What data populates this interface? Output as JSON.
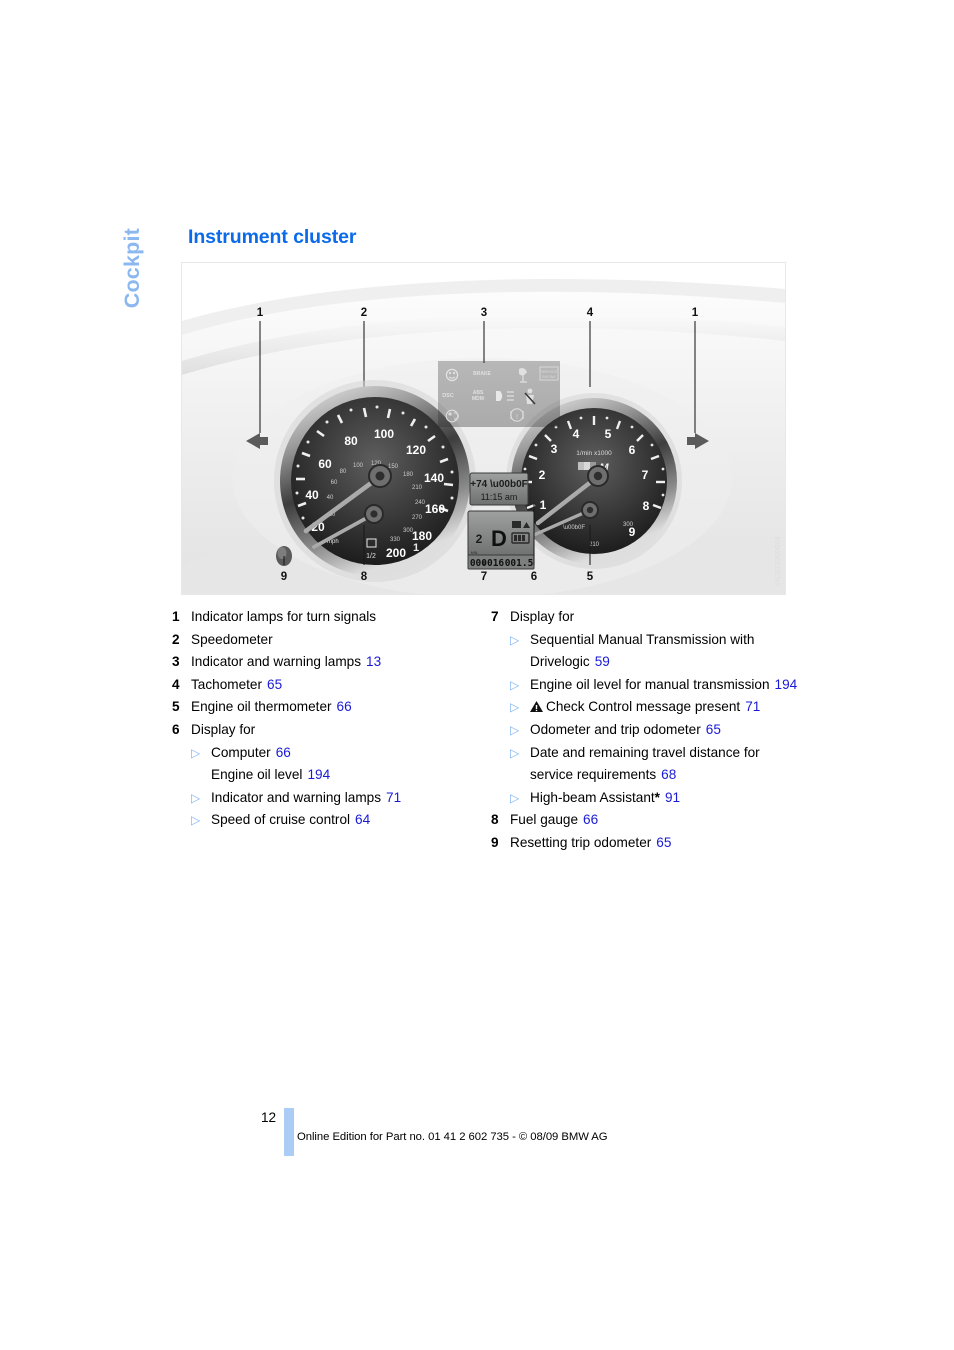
{
  "chapter_tab": {
    "label": "Cockpit",
    "color": "#8cb8f0"
  },
  "heading": {
    "title": "Instrument cluster",
    "color": "#0a6ae8"
  },
  "figure": {
    "alt": "BMW instrument cluster with speedometer and tachometer",
    "image_code": "VIC010200004",
    "callouts_top": [
      "1",
      "2",
      "3",
      "4",
      "1"
    ],
    "callouts_bottom": [
      "9",
      "8",
      "7",
      "6",
      "5"
    ],
    "speedometer": {
      "unit": "mph",
      "mph_ticks": [
        "20",
        "40",
        "60",
        "80",
        "100",
        "120",
        "140",
        "160",
        "180",
        "200"
      ],
      "kmh_label": "km/h",
      "kmh_ticks": [
        "20",
        "40",
        "60",
        "80",
        "100",
        "120",
        "150",
        "180",
        "210",
        "240",
        "270",
        "300",
        "330"
      ]
    },
    "tachometer": {
      "unit_label": "1/min x1000",
      "badge": "M",
      "ticks": [
        "1",
        "2",
        "3",
        "4",
        "5",
        "6",
        "7",
        "8",
        "9"
      ],
      "oil_temp_ticks": [
        "210",
        "300"
      ]
    },
    "display": {
      "outside_temp": "+74 °F",
      "clock": "11:15 am",
      "gear_number": "2",
      "gear_mode": "D",
      "odometer": "000016",
      "trip_odometer": "001.5"
    },
    "warning_lamps": [
      "airbag",
      "BRAKE",
      "seatbelt",
      "service-engine-soon",
      "DSC",
      "ABS/MDM",
      "high-beam",
      "airbag-passenger",
      "fog-lamp",
      "brake-pad",
      "handbrake"
    ]
  },
  "legend": {
    "left": [
      {
        "num": "1",
        "text": "Indicator lamps for turn signals",
        "ref": ""
      },
      {
        "num": "2",
        "text": "Speedometer",
        "ref": ""
      },
      {
        "num": "3",
        "text": "Indicator and warning lamps",
        "ref": "13"
      },
      {
        "num": "4",
        "text": "Tachometer",
        "ref": "65"
      },
      {
        "num": "5",
        "text": "Engine oil thermometer",
        "ref": "66"
      },
      {
        "num": "6",
        "text": "Display for",
        "ref": ""
      }
    ],
    "left_sub": [
      {
        "bullet": true,
        "text": "Computer",
        "ref": "66"
      },
      {
        "bullet": false,
        "text": "Engine oil level",
        "ref": "194"
      },
      {
        "bullet": true,
        "text": "Indicator and warning lamps",
        "ref": "71"
      },
      {
        "bullet": true,
        "text": "Speed of cruise control",
        "ref": "64"
      }
    ],
    "right_head": {
      "num": "7",
      "text": "Display for"
    },
    "right_sub": [
      {
        "bullet": true,
        "icon": "",
        "text": "Sequential Manual Transmission with Drivelogic",
        "ref": "59"
      },
      {
        "bullet": true,
        "icon": "",
        "text": "Engine oil level for manual transmission",
        "ref": "194"
      },
      {
        "bullet": true,
        "icon": "warning-triangle",
        "text": "Check Control message present",
        "ref": "71"
      },
      {
        "bullet": true,
        "icon": "",
        "text": "Odometer and trip odometer",
        "ref": "65"
      },
      {
        "bullet": true,
        "icon": "",
        "text": "Date and remaining travel distance for service requirements",
        "ref": "68"
      },
      {
        "bullet": true,
        "icon": "",
        "text": "High-beam Assistant",
        "star": "*",
        "ref": "91"
      }
    ],
    "right_tail": [
      {
        "num": "8",
        "text": "Fuel gauge",
        "ref": "66"
      },
      {
        "num": "9",
        "text": "Resetting trip odometer",
        "ref": "65"
      }
    ]
  },
  "footer": {
    "page_number": "12",
    "text": "Online Edition for Part no. 01 41 2 602 735 - © 08/09 BMW AG",
    "bar_color": "#aaccf5"
  }
}
